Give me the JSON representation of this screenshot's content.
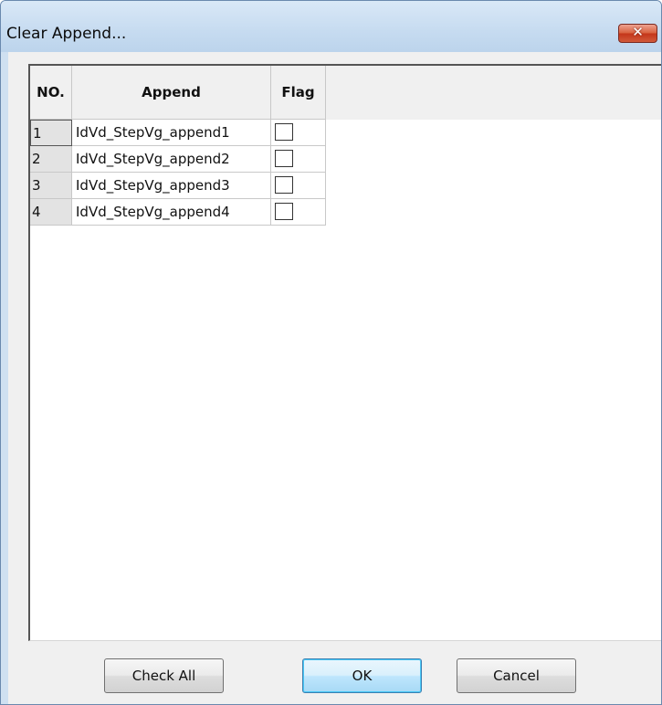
{
  "window": {
    "title": "Clear Append...",
    "close_glyph": "✕"
  },
  "table": {
    "headers": {
      "no": "NO.",
      "append": "Append",
      "flag": "Flag"
    },
    "rows": [
      {
        "no": "1",
        "append": "IdVd_StepVg_append1",
        "flag": false
      },
      {
        "no": "2",
        "append": "IdVd_StepVg_append2",
        "flag": false
      },
      {
        "no": "3",
        "append": "IdVd_StepVg_append3",
        "flag": false
      },
      {
        "no": "4",
        "append": "IdVd_StepVg_append4",
        "flag": false
      }
    ]
  },
  "buttons": {
    "check_all": "Check All",
    "ok": "OK",
    "cancel": "Cancel"
  },
  "colors": {
    "titlebar": "#c6dbf0",
    "close_button": "#d9613f",
    "ok_button_focus": "#3c7fb1"
  }
}
